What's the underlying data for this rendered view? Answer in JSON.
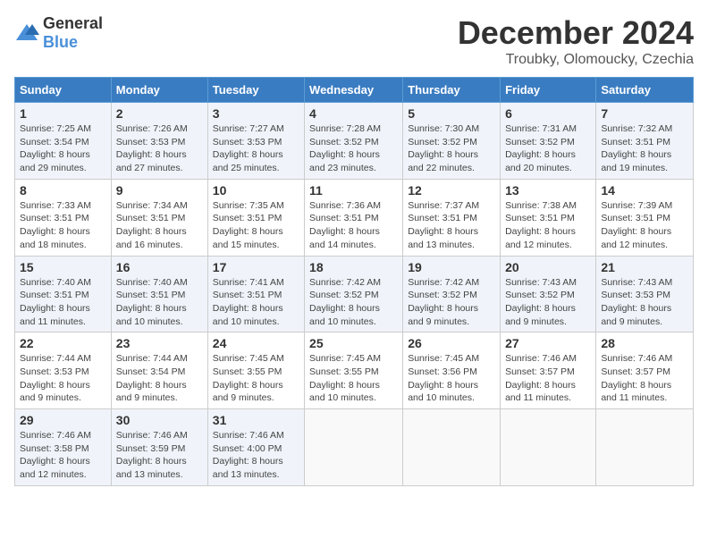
{
  "header": {
    "logo_general": "General",
    "logo_blue": "Blue",
    "month": "December 2024",
    "location": "Troubky, Olomoucky, Czechia"
  },
  "days_of_week": [
    "Sunday",
    "Monday",
    "Tuesday",
    "Wednesday",
    "Thursday",
    "Friday",
    "Saturday"
  ],
  "weeks": [
    [
      {
        "day": 1,
        "sunrise": "Sunrise: 7:25 AM",
        "sunset": "Sunset: 3:54 PM",
        "daylight": "Daylight: 8 hours and 29 minutes."
      },
      {
        "day": 2,
        "sunrise": "Sunrise: 7:26 AM",
        "sunset": "Sunset: 3:53 PM",
        "daylight": "Daylight: 8 hours and 27 minutes."
      },
      {
        "day": 3,
        "sunrise": "Sunrise: 7:27 AM",
        "sunset": "Sunset: 3:53 PM",
        "daylight": "Daylight: 8 hours and 25 minutes."
      },
      {
        "day": 4,
        "sunrise": "Sunrise: 7:28 AM",
        "sunset": "Sunset: 3:52 PM",
        "daylight": "Daylight: 8 hours and 23 minutes."
      },
      {
        "day": 5,
        "sunrise": "Sunrise: 7:30 AM",
        "sunset": "Sunset: 3:52 PM",
        "daylight": "Daylight: 8 hours and 22 minutes."
      },
      {
        "day": 6,
        "sunrise": "Sunrise: 7:31 AM",
        "sunset": "Sunset: 3:52 PM",
        "daylight": "Daylight: 8 hours and 20 minutes."
      },
      {
        "day": 7,
        "sunrise": "Sunrise: 7:32 AM",
        "sunset": "Sunset: 3:51 PM",
        "daylight": "Daylight: 8 hours and 19 minutes."
      }
    ],
    [
      {
        "day": 8,
        "sunrise": "Sunrise: 7:33 AM",
        "sunset": "Sunset: 3:51 PM",
        "daylight": "Daylight: 8 hours and 18 minutes."
      },
      {
        "day": 9,
        "sunrise": "Sunrise: 7:34 AM",
        "sunset": "Sunset: 3:51 PM",
        "daylight": "Daylight: 8 hours and 16 minutes."
      },
      {
        "day": 10,
        "sunrise": "Sunrise: 7:35 AM",
        "sunset": "Sunset: 3:51 PM",
        "daylight": "Daylight: 8 hours and 15 minutes."
      },
      {
        "day": 11,
        "sunrise": "Sunrise: 7:36 AM",
        "sunset": "Sunset: 3:51 PM",
        "daylight": "Daylight: 8 hours and 14 minutes."
      },
      {
        "day": 12,
        "sunrise": "Sunrise: 7:37 AM",
        "sunset": "Sunset: 3:51 PM",
        "daylight": "Daylight: 8 hours and 13 minutes."
      },
      {
        "day": 13,
        "sunrise": "Sunrise: 7:38 AM",
        "sunset": "Sunset: 3:51 PM",
        "daylight": "Daylight: 8 hours and 12 minutes."
      },
      {
        "day": 14,
        "sunrise": "Sunrise: 7:39 AM",
        "sunset": "Sunset: 3:51 PM",
        "daylight": "Daylight: 8 hours and 12 minutes."
      }
    ],
    [
      {
        "day": 15,
        "sunrise": "Sunrise: 7:40 AM",
        "sunset": "Sunset: 3:51 PM",
        "daylight": "Daylight: 8 hours and 11 minutes."
      },
      {
        "day": 16,
        "sunrise": "Sunrise: 7:40 AM",
        "sunset": "Sunset: 3:51 PM",
        "daylight": "Daylight: 8 hours and 10 minutes."
      },
      {
        "day": 17,
        "sunrise": "Sunrise: 7:41 AM",
        "sunset": "Sunset: 3:51 PM",
        "daylight": "Daylight: 8 hours and 10 minutes."
      },
      {
        "day": 18,
        "sunrise": "Sunrise: 7:42 AM",
        "sunset": "Sunset: 3:52 PM",
        "daylight": "Daylight: 8 hours and 10 minutes."
      },
      {
        "day": 19,
        "sunrise": "Sunrise: 7:42 AM",
        "sunset": "Sunset: 3:52 PM",
        "daylight": "Daylight: 8 hours and 9 minutes."
      },
      {
        "day": 20,
        "sunrise": "Sunrise: 7:43 AM",
        "sunset": "Sunset: 3:52 PM",
        "daylight": "Daylight: 8 hours and 9 minutes."
      },
      {
        "day": 21,
        "sunrise": "Sunrise: 7:43 AM",
        "sunset": "Sunset: 3:53 PM",
        "daylight": "Daylight: 8 hours and 9 minutes."
      }
    ],
    [
      {
        "day": 22,
        "sunrise": "Sunrise: 7:44 AM",
        "sunset": "Sunset: 3:53 PM",
        "daylight": "Daylight: 8 hours and 9 minutes."
      },
      {
        "day": 23,
        "sunrise": "Sunrise: 7:44 AM",
        "sunset": "Sunset: 3:54 PM",
        "daylight": "Daylight: 8 hours and 9 minutes."
      },
      {
        "day": 24,
        "sunrise": "Sunrise: 7:45 AM",
        "sunset": "Sunset: 3:55 PM",
        "daylight": "Daylight: 8 hours and 9 minutes."
      },
      {
        "day": 25,
        "sunrise": "Sunrise: 7:45 AM",
        "sunset": "Sunset: 3:55 PM",
        "daylight": "Daylight: 8 hours and 10 minutes."
      },
      {
        "day": 26,
        "sunrise": "Sunrise: 7:45 AM",
        "sunset": "Sunset: 3:56 PM",
        "daylight": "Daylight: 8 hours and 10 minutes."
      },
      {
        "day": 27,
        "sunrise": "Sunrise: 7:46 AM",
        "sunset": "Sunset: 3:57 PM",
        "daylight": "Daylight: 8 hours and 11 minutes."
      },
      {
        "day": 28,
        "sunrise": "Sunrise: 7:46 AM",
        "sunset": "Sunset: 3:57 PM",
        "daylight": "Daylight: 8 hours and 11 minutes."
      }
    ],
    [
      {
        "day": 29,
        "sunrise": "Sunrise: 7:46 AM",
        "sunset": "Sunset: 3:58 PM",
        "daylight": "Daylight: 8 hours and 12 minutes."
      },
      {
        "day": 30,
        "sunrise": "Sunrise: 7:46 AM",
        "sunset": "Sunset: 3:59 PM",
        "daylight": "Daylight: 8 hours and 13 minutes."
      },
      {
        "day": 31,
        "sunrise": "Sunrise: 7:46 AM",
        "sunset": "Sunset: 4:00 PM",
        "daylight": "Daylight: 8 hours and 13 minutes."
      },
      null,
      null,
      null,
      null
    ]
  ]
}
